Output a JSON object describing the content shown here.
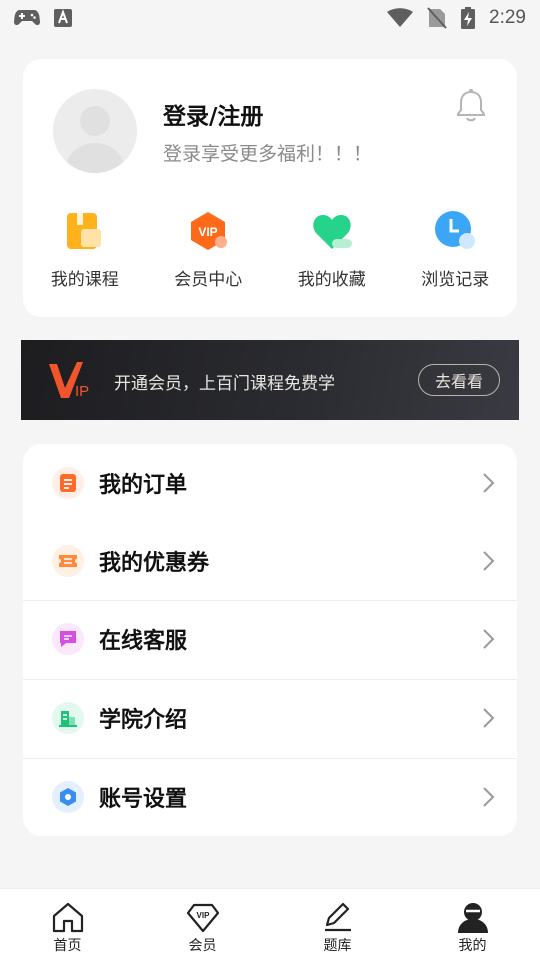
{
  "status_bar": {
    "time": "2:29",
    "left_icons": [
      "gamepad-icon",
      "keyboard-a-icon"
    ],
    "right_icons": [
      "wifi-icon",
      "no-sim-icon",
      "battery-charging-icon"
    ]
  },
  "profile": {
    "title": "登录/注册",
    "subtitle": "登录享受更多福利！！！",
    "notification_icon": "bell-icon"
  },
  "quick_links": [
    {
      "label": "我的课程",
      "icon": "course-icon",
      "color": "#ffb21a"
    },
    {
      "label": "会员中心",
      "icon": "vip-icon",
      "color": "#ff6a1a"
    },
    {
      "label": "我的收藏",
      "icon": "heart-icon",
      "color": "#25d48a"
    },
    {
      "label": "浏览记录",
      "icon": "clock-icon",
      "color": "#3aa6f5"
    }
  ],
  "banner": {
    "logo_text": "VIP",
    "text": "开通会员，上百门课程免费学",
    "button": "去看看"
  },
  "menu": [
    {
      "label": "我的订单",
      "icon": "order-icon",
      "color": "#ff6a2a"
    },
    {
      "label": "我的优惠券",
      "icon": "coupon-icon",
      "color": "#ff8a3d"
    },
    {
      "label": "在线客服",
      "icon": "chat-icon",
      "color": "#d64fe0"
    },
    {
      "label": "学院介绍",
      "icon": "building-icon",
      "color": "#1fc27a"
    },
    {
      "label": "账号设置",
      "icon": "settings-icon",
      "color": "#3a8ef0"
    }
  ],
  "tabbar": [
    {
      "label": "首页",
      "icon": "home-icon"
    },
    {
      "label": "会员",
      "icon": "vip-diamond-icon"
    },
    {
      "label": "题库",
      "icon": "pen-icon"
    },
    {
      "label": "我的",
      "icon": "user-icon",
      "active": true
    }
  ]
}
